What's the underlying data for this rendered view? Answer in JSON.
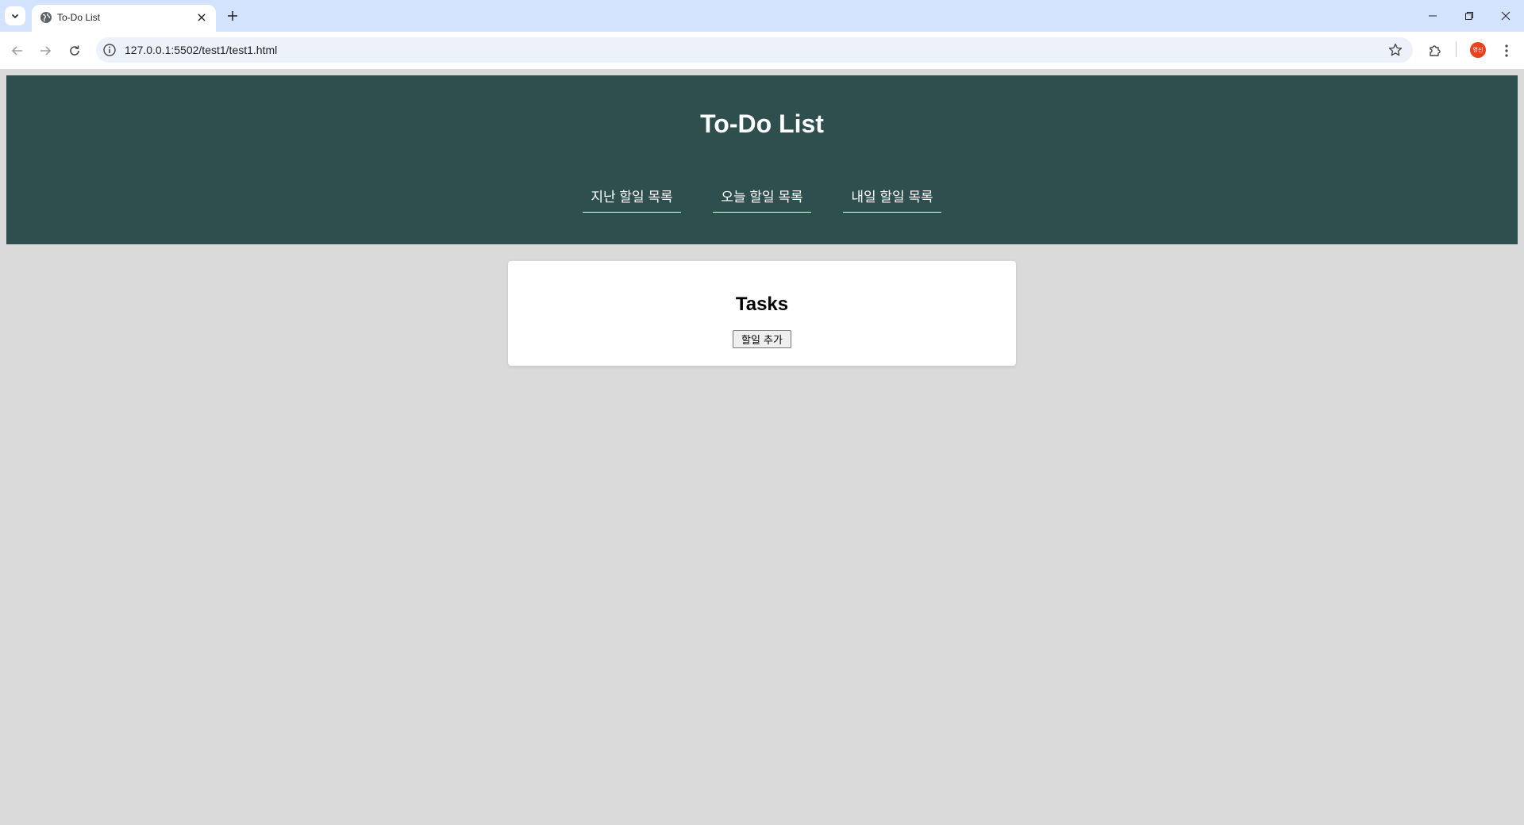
{
  "browser": {
    "tab_title": "To-Do List",
    "url": "127.0.0.1:5502/test1/test1.html",
    "profile_initials": "영신"
  },
  "icons": {
    "tab_search": "chevron-down-icon",
    "favicon": "globe-icon",
    "tab_close": "close-icon",
    "new_tab": "plus-icon",
    "minimize": "minimize-icon",
    "restore": "restore-icon",
    "close_window": "close-icon",
    "back": "arrow-left-icon",
    "forward": "arrow-right-icon",
    "reload": "reload-icon",
    "site_info": "info-icon",
    "bookmark": "star-icon",
    "extensions": "puzzle-icon",
    "menu": "kebab-menu-icon"
  },
  "colors": {
    "header_bg": "#2f4f4f",
    "page_bg": "#dadada",
    "card_bg": "#ffffff",
    "avatar_bg": "#e8431f",
    "tabstrip_bg": "#d3e3fd"
  },
  "page": {
    "title": "To-Do List",
    "nav": [
      {
        "label": "지난 할일 목록"
      },
      {
        "label": "오늘 할일 목록"
      },
      {
        "label": "내일 할일 목록"
      }
    ],
    "card": {
      "title": "Tasks",
      "add_button": "할일 추가"
    }
  }
}
